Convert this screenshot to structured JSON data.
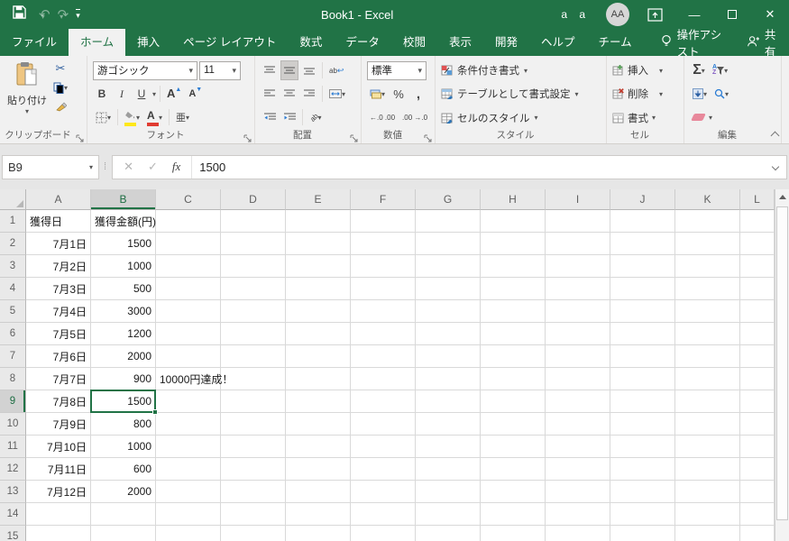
{
  "titlebar": {
    "title": "Book1 - Excel",
    "mode_letters": "a a",
    "avatar_initials": "AA"
  },
  "tabs": [
    {
      "key": "file",
      "label": "ファイル",
      "active": false
    },
    {
      "key": "home",
      "label": "ホーム",
      "active": true
    },
    {
      "key": "insert",
      "label": "挿入",
      "active": false
    },
    {
      "key": "page-layout",
      "label": "ページ レイアウト",
      "active": false
    },
    {
      "key": "formulas",
      "label": "数式",
      "active": false
    },
    {
      "key": "data",
      "label": "データ",
      "active": false
    },
    {
      "key": "review",
      "label": "校閲",
      "active": false
    },
    {
      "key": "view",
      "label": "表示",
      "active": false
    },
    {
      "key": "developer",
      "label": "開発",
      "active": false
    },
    {
      "key": "help",
      "label": "ヘルプ",
      "active": false
    },
    {
      "key": "team",
      "label": "チーム",
      "active": false
    }
  ],
  "assist_tab": "操作アシスト",
  "share_button": "共有",
  "ribbon": {
    "clipboard": {
      "group_label": "クリップボード",
      "paste_label": "貼り付け"
    },
    "font": {
      "group_label": "フォント",
      "font_name": "游ゴシック",
      "font_size": "11",
      "bold": "B",
      "italic": "I",
      "underline": "U",
      "grow_shrink": "A",
      "phonetic": "亜"
    },
    "alignment": {
      "group_label": "配置",
      "wrap_text": "ab"
    },
    "number": {
      "group_label": "数値",
      "format": "標準",
      "percent": "%",
      "comma": ",",
      "increase_decimal": "←.0 .00",
      "decrease_decimal": ".00 →.0"
    },
    "styles": {
      "group_label": "スタイル",
      "conditional": "条件付き書式",
      "format_table": "テーブルとして書式設定",
      "cell_styles": "セルのスタイル"
    },
    "cells": {
      "group_label": "セル",
      "insert": "挿入",
      "delete": "削除",
      "format": "書式"
    },
    "editing": {
      "group_label": "編集",
      "autosum": "Σ"
    }
  },
  "formula_bar": {
    "name_box": "B9",
    "fx_label": "fx",
    "value": "1500"
  },
  "sheet": {
    "columns": [
      "A",
      "B",
      "C",
      "D",
      "E",
      "F",
      "G",
      "H",
      "I",
      "J",
      "K",
      "L"
    ],
    "selected": {
      "column": "B",
      "row": 9,
      "ref": "B9"
    },
    "rows": [
      {
        "n": 1,
        "A": "獲得日",
        "B": "獲得金額(円)"
      },
      {
        "n": 2,
        "A": "7月1日",
        "B": "1500"
      },
      {
        "n": 3,
        "A": "7月2日",
        "B": "1000"
      },
      {
        "n": 4,
        "A": "7月3日",
        "B": "500"
      },
      {
        "n": 5,
        "A": "7月4日",
        "B": "3000"
      },
      {
        "n": 6,
        "A": "7月5日",
        "B": "1200"
      },
      {
        "n": 7,
        "A": "7月6日",
        "B": "2000"
      },
      {
        "n": 8,
        "A": "7月7日",
        "B": "900",
        "C": "10000円達成！"
      },
      {
        "n": 9,
        "A": "7月8日",
        "B": "1500"
      },
      {
        "n": 10,
        "A": "7月9日",
        "B": "800"
      },
      {
        "n": 11,
        "A": "7月10日",
        "B": "1000"
      },
      {
        "n": 12,
        "A": "7月11日",
        "B": "600"
      },
      {
        "n": 13,
        "A": "7月12日",
        "B": "2000"
      },
      {
        "n": 14
      },
      {
        "n": 15
      }
    ]
  },
  "colors": {
    "accent_green": "#217346",
    "selection_border": "#217346",
    "fill_yellow": "#ffe81a",
    "font_red": "#e03c32"
  }
}
